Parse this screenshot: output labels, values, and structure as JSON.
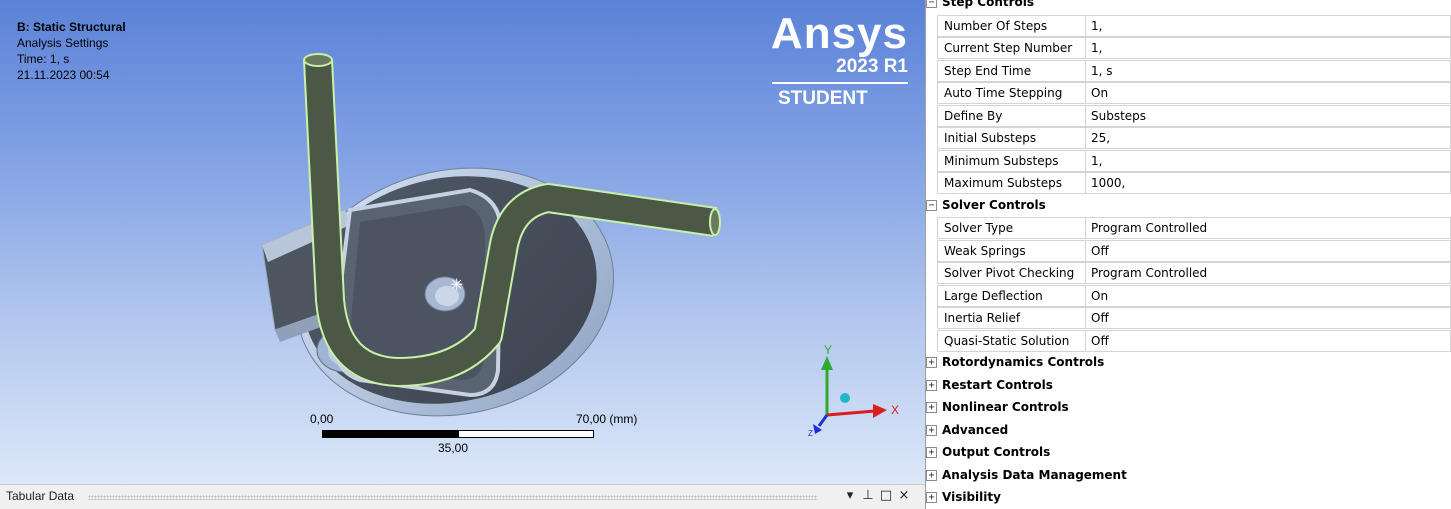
{
  "viewport": {
    "analysis": {
      "title": "B: Static Structural",
      "object": "Analysis Settings",
      "time": "Time: 1, s",
      "date": "21.11.2023 00:54"
    },
    "logo": {
      "brand": "Ansys",
      "release": "2023 R1",
      "edition": "STUDENT"
    },
    "scale": {
      "left": "0,00",
      "right": "70,00 (mm)",
      "mid": "35,00"
    },
    "triad": {
      "x": "X",
      "y": "Y",
      "z": "Z"
    },
    "colors": {
      "bg_top": "#5b82d8",
      "bg_bottom": "#dce7f8",
      "wire": "#4b5846",
      "wire_edge": "#c8f0a8"
    }
  },
  "tabular": {
    "title": "Tabular Data",
    "controls": {
      "dropdown": "▾",
      "pin": "⊥",
      "maximize": "□",
      "close": "×"
    }
  },
  "details": {
    "rows": [
      {
        "type": "section",
        "expander": "−",
        "label": "Step Controls"
      },
      {
        "type": "prop",
        "name": "Number Of Steps",
        "value": "1,"
      },
      {
        "type": "prop",
        "name": "Current Step Number",
        "value": "1,"
      },
      {
        "type": "prop",
        "name": "Step End Time",
        "value": "1, s"
      },
      {
        "type": "prop",
        "name": "Auto Time Stepping",
        "value": "On"
      },
      {
        "type": "prop",
        "name": "Define By",
        "value": "Substeps"
      },
      {
        "type": "prop",
        "name": "Initial Substeps",
        "value": "25,"
      },
      {
        "type": "prop",
        "name": "Minimum Substeps",
        "value": "1,"
      },
      {
        "type": "prop",
        "name": "Maximum Substeps",
        "value": "1000,"
      },
      {
        "type": "section",
        "expander": "−",
        "label": "Solver Controls"
      },
      {
        "type": "prop",
        "name": "Solver Type",
        "value": "Program Controlled"
      },
      {
        "type": "prop",
        "name": "Weak Springs",
        "value": "Off"
      },
      {
        "type": "prop",
        "name": "Solver Pivot Checking",
        "value": "Program Controlled"
      },
      {
        "type": "prop",
        "name": "Large Deflection",
        "value": "On"
      },
      {
        "type": "prop",
        "name": "Inertia Relief",
        "value": "Off"
      },
      {
        "type": "prop",
        "name": "Quasi-Static Solution",
        "value": "Off"
      },
      {
        "type": "section",
        "expander": "+",
        "label": "Rotordynamics Controls"
      },
      {
        "type": "section",
        "expander": "+",
        "label": "Restart Controls"
      },
      {
        "type": "section",
        "expander": "+",
        "label": "Nonlinear Controls"
      },
      {
        "type": "section",
        "expander": "+",
        "label": "Advanced"
      },
      {
        "type": "section",
        "expander": "+",
        "label": "Output Controls"
      },
      {
        "type": "section",
        "expander": "+",
        "label": "Analysis Data Management"
      },
      {
        "type": "section",
        "expander": "+",
        "label": "Visibility"
      }
    ]
  }
}
